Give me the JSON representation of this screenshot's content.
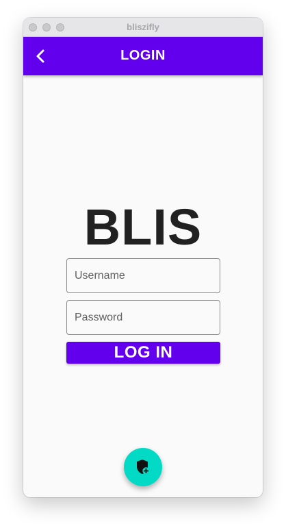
{
  "window": {
    "title": "bliszifly"
  },
  "appbar": {
    "title": "LOGIN",
    "back_icon": "chevron-left-icon"
  },
  "logo": {
    "text": "BLIS"
  },
  "form": {
    "username_placeholder": "Username",
    "password_placeholder": "Password",
    "submit_label": "LOG IN"
  },
  "fab": {
    "icon": "shield-plus-icon"
  },
  "colors": {
    "primary": "#6200ee",
    "secondary": "#03dac6",
    "background": "#fafafa",
    "logo_text": "#212121"
  }
}
